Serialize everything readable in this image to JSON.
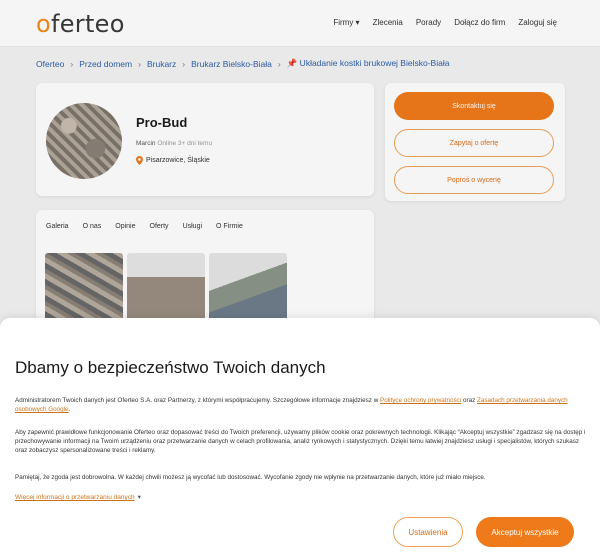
{
  "header": {
    "logo_prefix": "",
    "logo_o": "o",
    "logo_rest": "ferteo",
    "nav": [
      "Firmy ▾",
      "Zlecenia",
      "Porady",
      "Dołącz do firm",
      "Zaloguj się"
    ]
  },
  "breadcrumbs": [
    "Oferteo",
    "Przed domem",
    "Brukarz",
    "Brukarz Bielsko-Biała",
    "📌 Układanie kostki brukowej Bielsko-Biała"
  ],
  "breadcrumb_sep": "›",
  "profile": {
    "name": "Pro-Bud",
    "contact": "Marcin",
    "online": "Online 3+ dni temu",
    "location": "Pisarzowice, Śląskie"
  },
  "actions": {
    "contact": "Skontaktuj się",
    "ask_offer": "Zapytaj o ofertę",
    "ask_quote": "Poproś o wycenę"
  },
  "tabs": [
    "Galeria",
    "O nas",
    "Opinie",
    "Oferty",
    "Usługi",
    "O Firmie"
  ],
  "cookie": {
    "title": "Dbamy o bezpieczeństwo Twoich danych",
    "p1_a": "Administratorem Twoich danych jest Oferteo S.A. oraz Partnerzy, z którymi współpracujemy. Szczegółowe informacje znajdziesz w ",
    "p1_link1": "Polityce ochrony prywatności",
    "p1_b": " oraz ",
    "p1_link2": "Zasadach przetwarzania danych osobowych Google",
    "p1_c": ".",
    "p2": "Aby zapewnić prawidłowe funkcjonowanie Oferteo oraz dopasować treści do Twoich preferencji, używamy plików cookie oraz pokrewnych technologii. Klikając “Akceptuj wszystkie” zgadzasz się na dostęp i przechowywanie informacji na Twoim urządzeniu oraz przetwarzanie danych w celach profilowania, analiz rynkowych i statystycznych. Dzięki temu łatwiej znajdziesz usługi i specjalistów, których szukasz oraz zobaczysz spersonalizowane treści i reklamy.",
    "p3": "Pamiętaj, że zgoda jest dobrowolna. W każdej chwili możesz ją wycofać lub dostosować. Wycofanie zgody nie wpłynie na przetwarzanie danych, które już miało miejsce.",
    "more": "Więcej informacji o przetwarzaniu danych",
    "more_chevron": "▾",
    "settings": "Ustawienia",
    "accept": "Akceptuj wszystkie"
  },
  "colors": {
    "accent": "#ef7a1a",
    "link": "#2d5fa8"
  }
}
